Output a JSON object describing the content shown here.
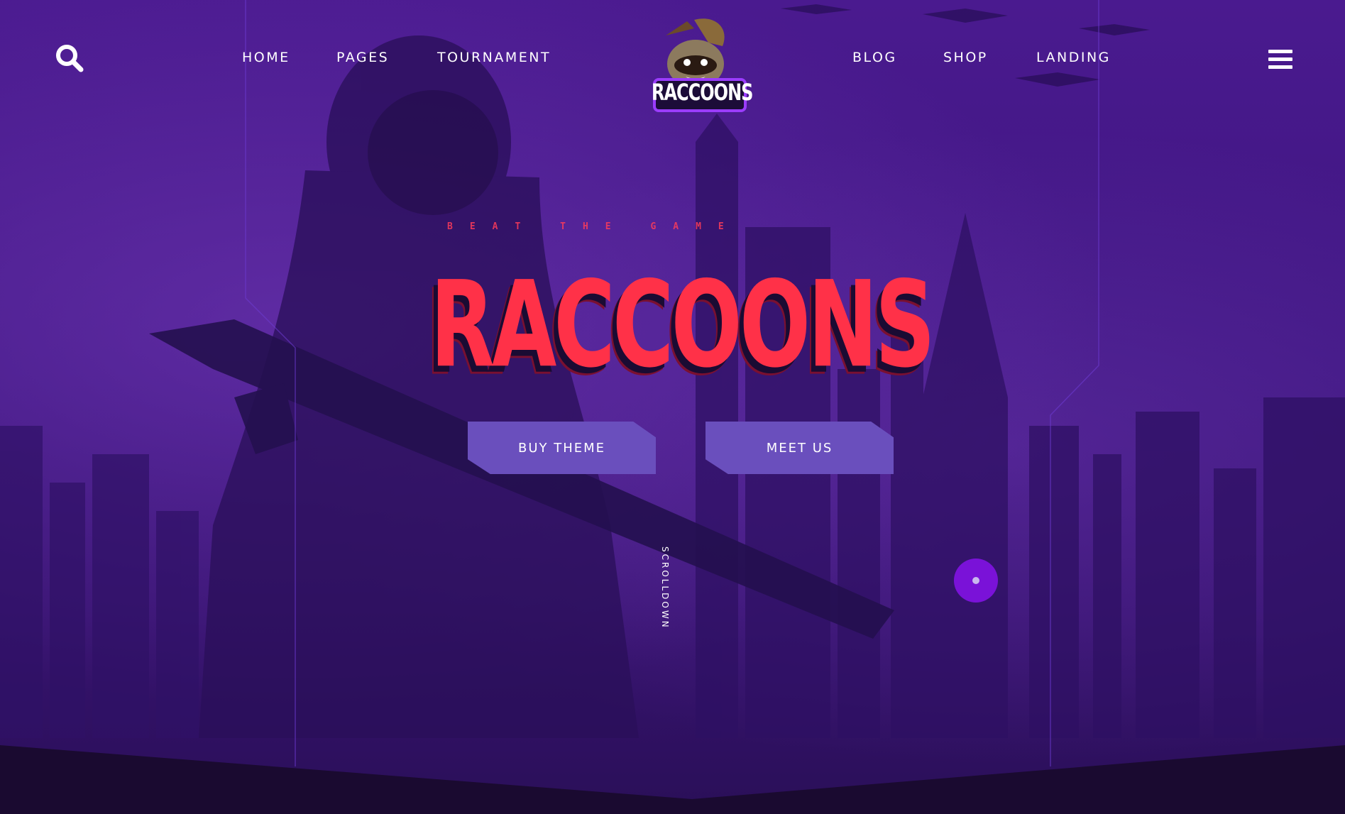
{
  "header": {
    "search_icon": "search-icon",
    "menu_icon": "hamburger-menu-icon",
    "nav_left": [
      "HOME",
      "PAGES",
      "TOURNAMENT"
    ],
    "nav_right": [
      "BLOG",
      "SHOP",
      "LANDING"
    ],
    "logo_text": "RACCOONS"
  },
  "hero": {
    "tagline": "BEAT THE GAME",
    "title": "RACCOONS",
    "buttons": {
      "primary": "BUY THEME",
      "secondary": "MEET US"
    },
    "scroll_label": "SCROLLDOWN"
  },
  "colors": {
    "background": "#3e1680",
    "accent_red": "#ff3148",
    "button": "#6a4fbd",
    "dot": "#7a12d8"
  }
}
